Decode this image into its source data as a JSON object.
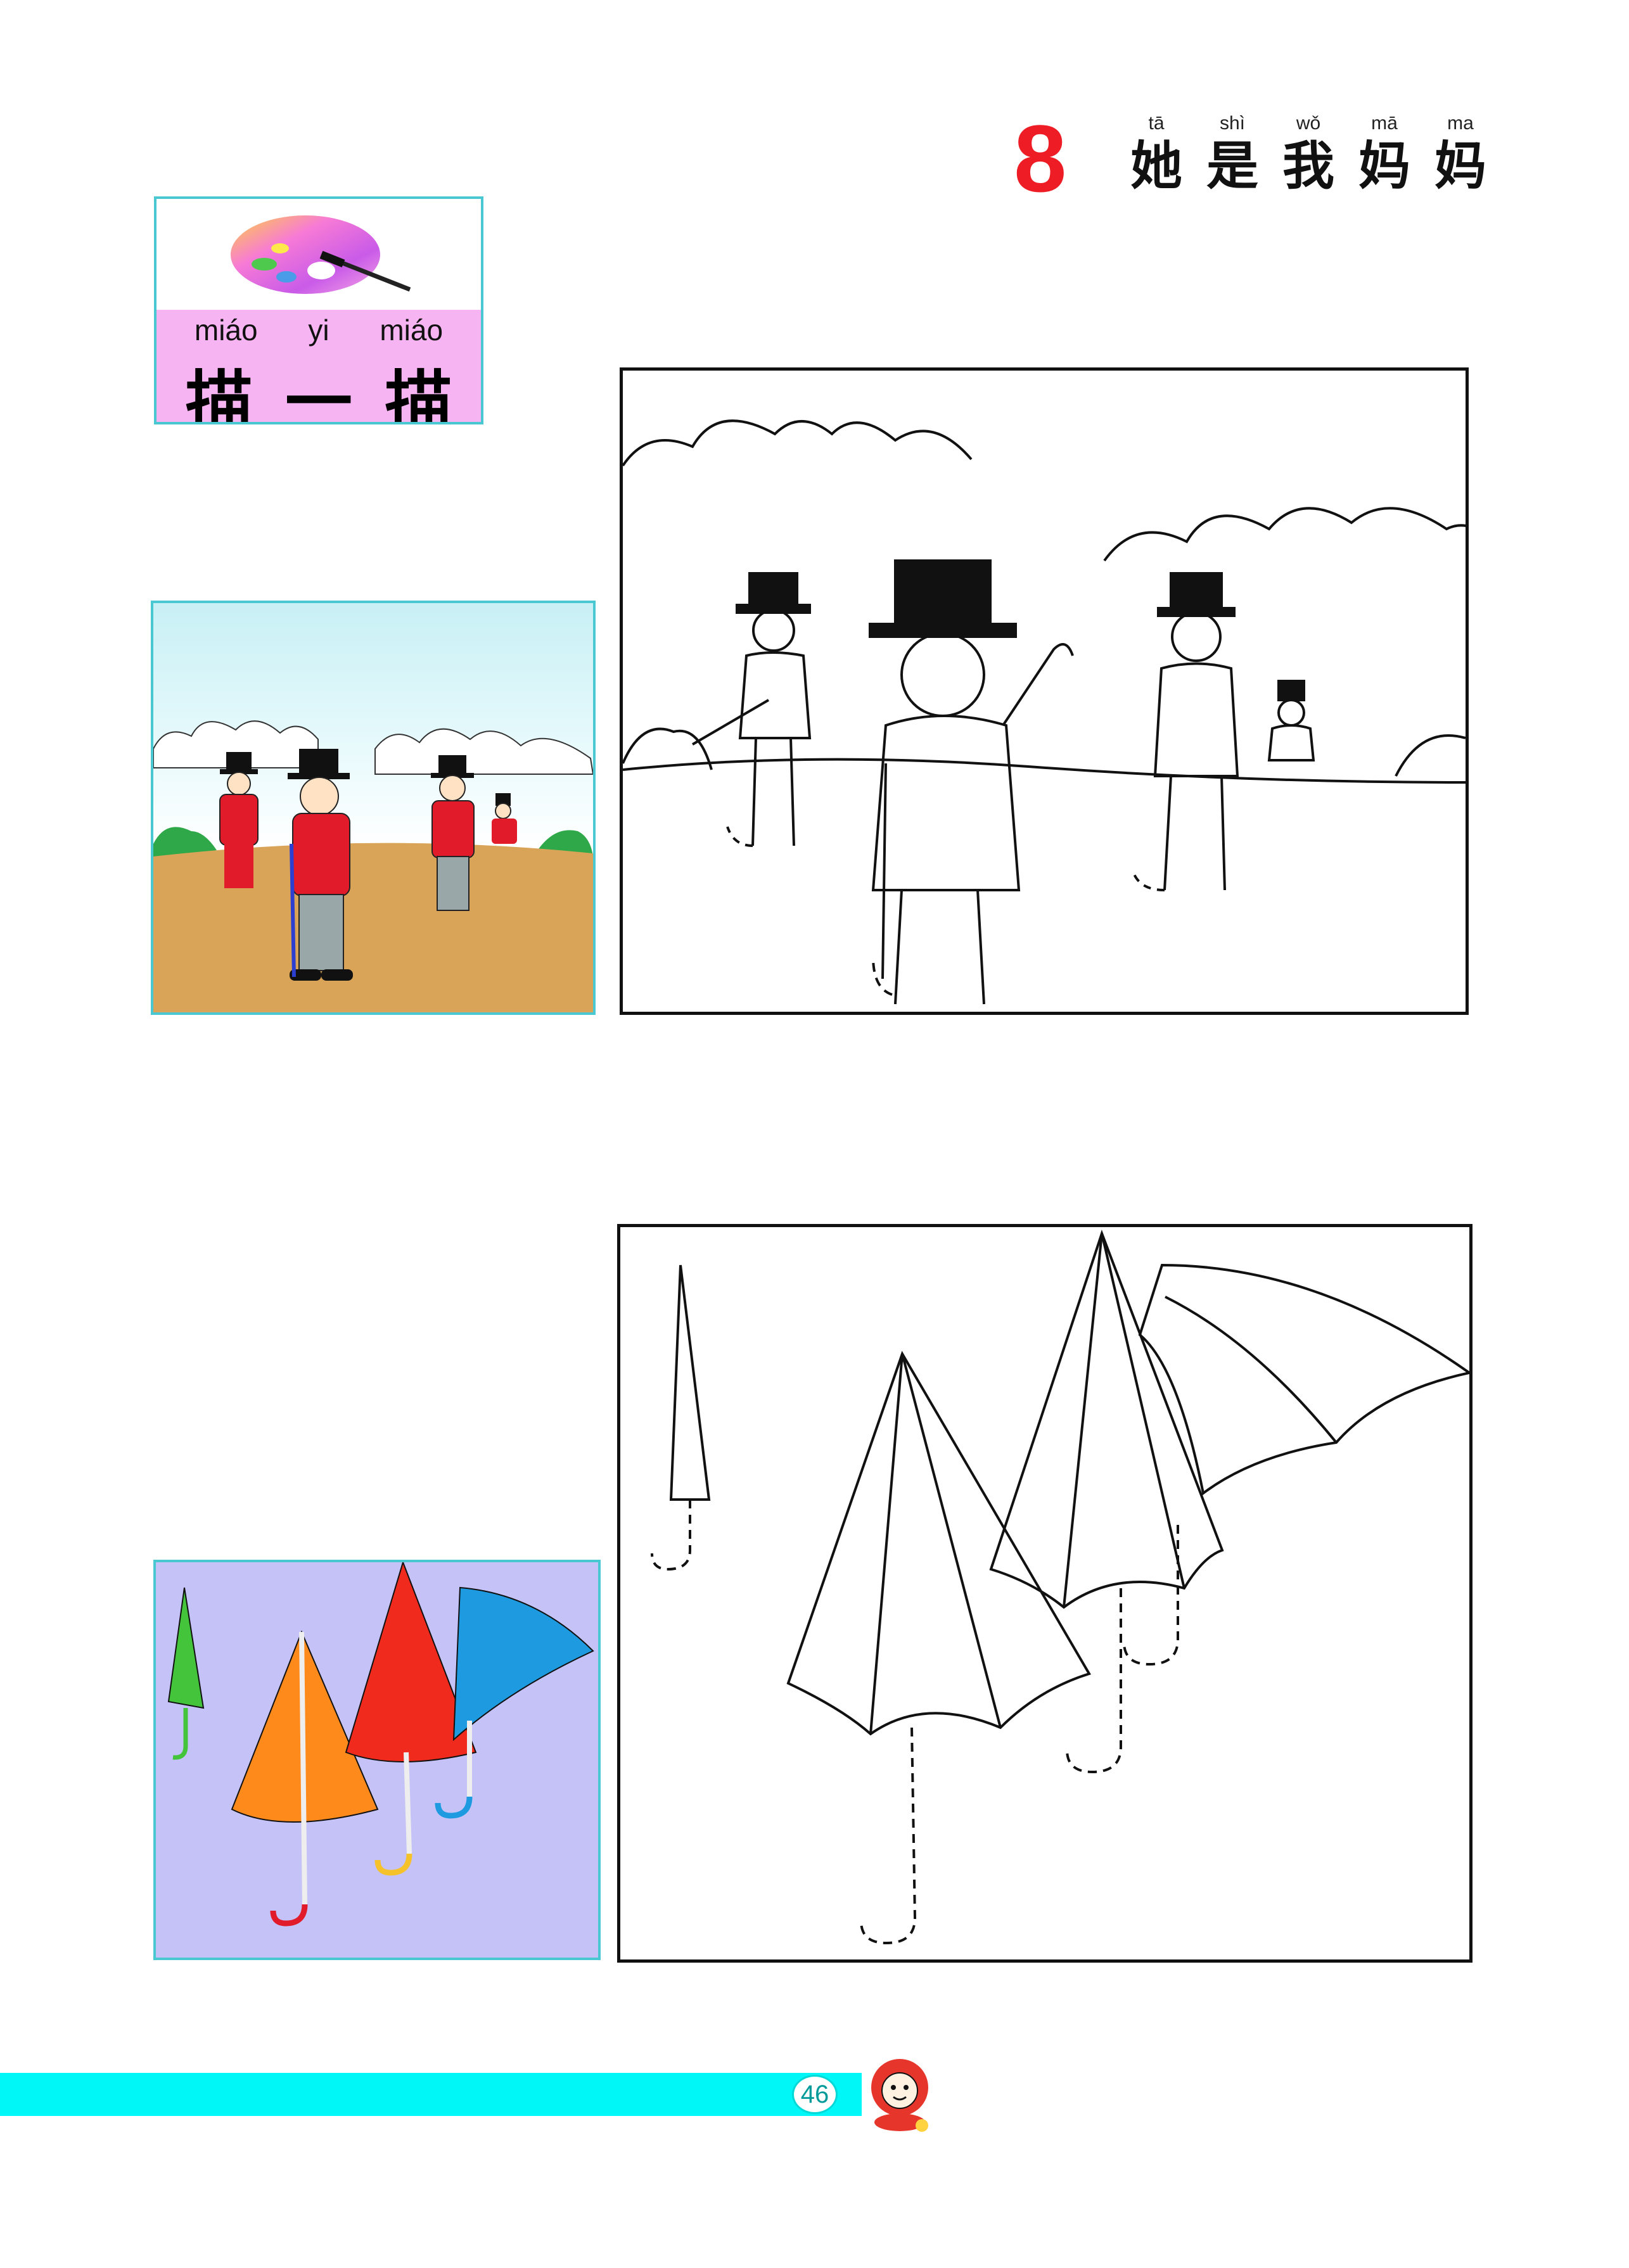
{
  "lesson": {
    "number": "8",
    "title_chars": [
      {
        "pinyin": "tā",
        "hanzi": "她"
      },
      {
        "pinyin": "shì",
        "hanzi": "是"
      },
      {
        "pinyin": "wǒ",
        "hanzi": "我"
      },
      {
        "pinyin": "mā",
        "hanzi": "妈"
      },
      {
        "pinyin": "ma",
        "hanzi": "妈"
      }
    ]
  },
  "activity_label": {
    "pinyin": [
      "miáo",
      "yi",
      "miáo"
    ],
    "hanzi": [
      "描",
      "一",
      "描"
    ]
  },
  "footer": {
    "page_number": "46"
  },
  "colors": {
    "title_number": "#ee1c25",
    "frame_cyan": "#49c8d2",
    "label_pink": "#f7b4f2",
    "footer_bar": "#00f7f7",
    "umbrella_bg": "#c5c2f7"
  }
}
